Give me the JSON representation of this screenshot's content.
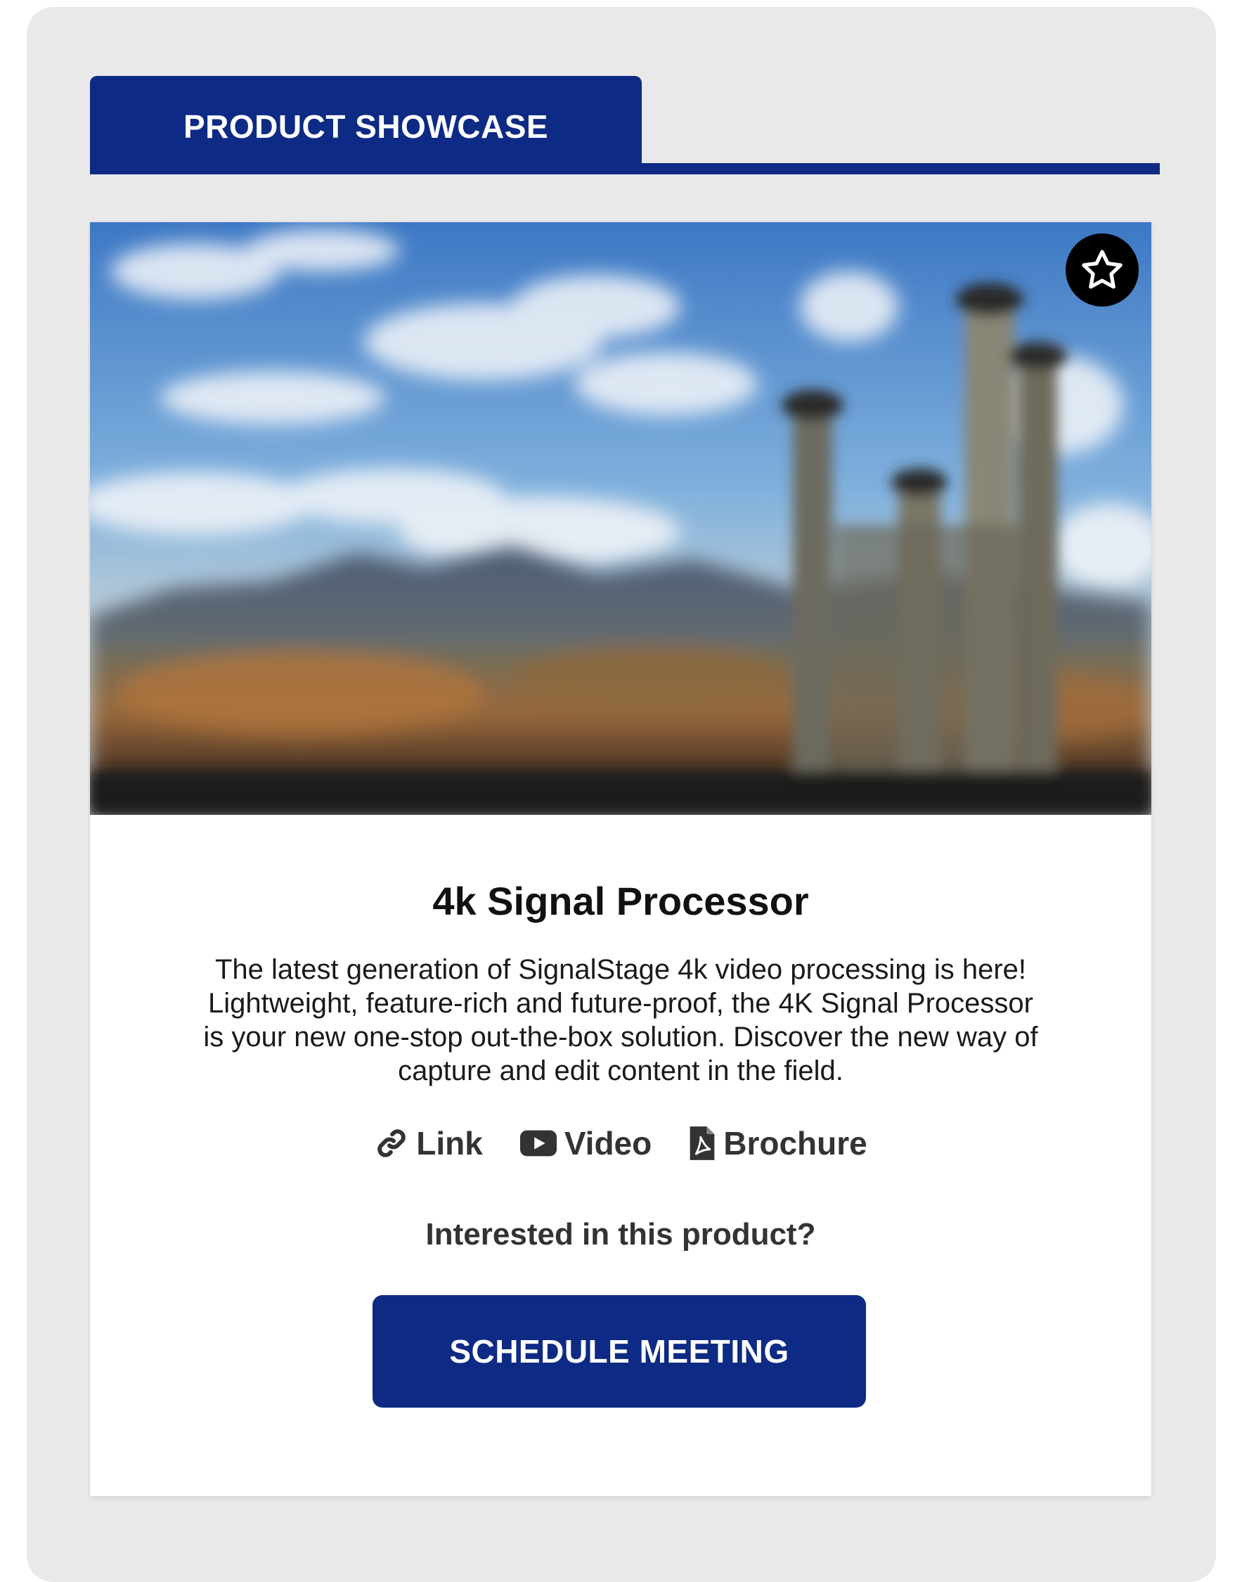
{
  "header": {
    "tab_label": "PRODUCT SHOWCASE"
  },
  "product": {
    "title": "4k Signal Processor",
    "description": "The latest generation of SignalStage 4k video processing is here! Lightweight, feature-rich and future-proof, the 4K Signal Processor is your new one-stop out-the-box solution. Discover the new way of capture and edit content in the field.",
    "image_icon": "favorite-star-icon",
    "links": [
      {
        "label": "Link",
        "icon": "link-icon"
      },
      {
        "label": "Video",
        "icon": "youtube-play-icon"
      },
      {
        "label": "Brochure",
        "icon": "pdf-file-icon"
      }
    ]
  },
  "cta": {
    "question": "Interested in this product?",
    "button_label": "SCHEDULE MEETING"
  },
  "colors": {
    "brand": "#0d2a84",
    "panel_bg": "#e9e9e9",
    "card_bg": "#ffffff"
  }
}
